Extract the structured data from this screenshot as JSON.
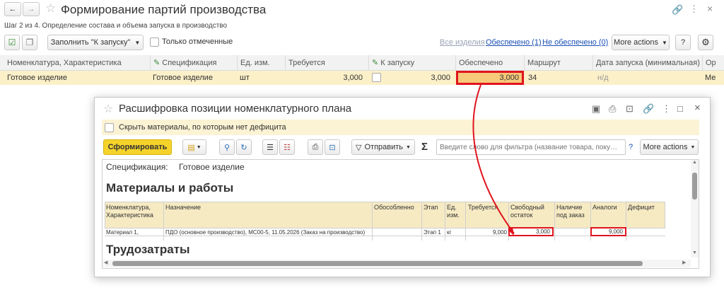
{
  "header": {
    "title": "Формирование партий производства",
    "step": "Шаг 2 из 4. Определение состава и объема запуска в производство"
  },
  "toolbar": {
    "fill_label": "Заполнить \"К запуску\"",
    "only_marked": "Только отмеченные",
    "link_all": "Все изделия",
    "link_provided": "Обеспечено (1)",
    "link_not_provided": "Не обеспечено (0)",
    "more_actions": "More actions",
    "help": "?"
  },
  "table": {
    "columns": [
      "Номенклатура, Характеристика",
      "Спецификация",
      "Ед. изм.",
      "Требуется",
      "К запуску",
      "Обеспечено",
      "Маршрут",
      "Дата запуска (минимальная)",
      "Ор"
    ],
    "row": {
      "nomenclature": "Готовое изделие",
      "spec": "Готовое изделие",
      "unit": "шт",
      "required": "3,000",
      "to_launch": "3,000",
      "provided": "3,000",
      "route": "34",
      "date": "н/д",
      "org": "Ме"
    }
  },
  "dialog": {
    "title": "Расшифровка позиции номенклатурного плана",
    "hide_materials": "Скрыть материалы, по которым нет дефицита",
    "generate": "Сформировать",
    "send": "Отправить",
    "filter_placeholder": "Введите слово для фильтра (название товара, поку…",
    "help": "?",
    "more_actions": "More actions",
    "spec_label": "Спецификация:",
    "spec_value": "Готовое изделие",
    "section_materials": "Материалы и работы",
    "section_labor": "Трудозатраты",
    "report_columns": {
      "nom": "Номенклатура, Характеристика",
      "purpose": "Назначение",
      "separate": "Обособленно",
      "stage": "Этап",
      "unit": "Ед. изм.",
      "required": "Требуется",
      "free": "Свободный остаток",
      "order": "Наличие под заказ",
      "analogs": "Аналоги",
      "deficit": "Дефицит"
    },
    "report_row": {
      "nom": "Материал 1,",
      "purpose": "ПДО (основное производство), МС00-5, 11.05.2026 (Заказ на производство)",
      "stage": "Этап 1",
      "unit": "кг",
      "required": "9,000",
      "free": "3,000",
      "analogs": "9,000"
    }
  },
  "colors": {
    "highlight": "#e0141e",
    "row_bg": "#fbf0c8",
    "generate_bg": "#f5d32a"
  }
}
